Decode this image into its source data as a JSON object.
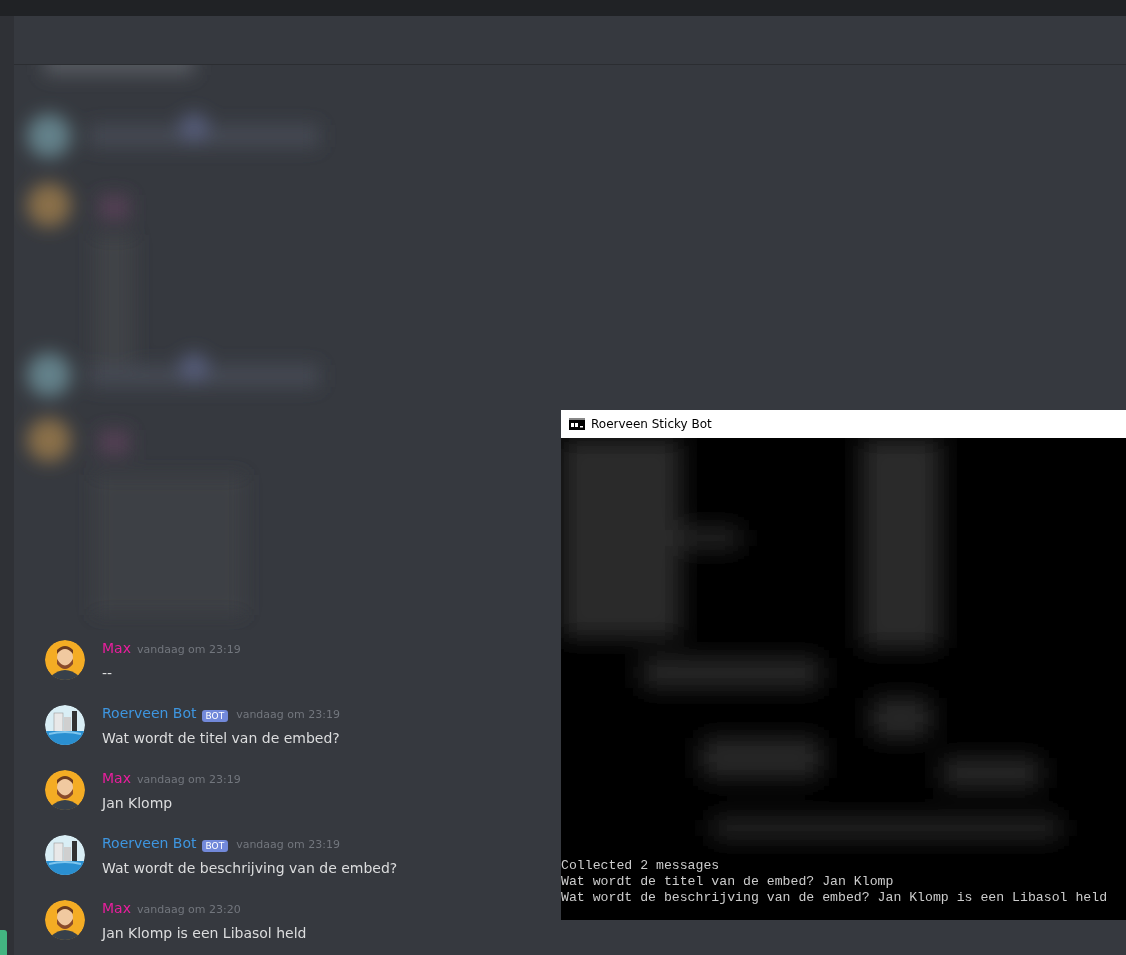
{
  "messages": [
    {
      "kind": "user",
      "author": "Max",
      "color": "#e91e9d",
      "time": "vandaag om 23:19",
      "text": "--"
    },
    {
      "kind": "bot",
      "author": "Roerveen Bot",
      "color": "#3e96e0",
      "badge": "BOT",
      "time": "vandaag om 23:19",
      "text": "Wat wordt de titel van de embed?"
    },
    {
      "kind": "user",
      "author": "Max",
      "color": "#e91e9d",
      "time": "vandaag om 23:19",
      "text": "Jan Klomp"
    },
    {
      "kind": "bot",
      "author": "Roerveen Bot",
      "color": "#3e96e0",
      "badge": "BOT",
      "time": "vandaag om 23:19",
      "text": "Wat wordt de beschrijving van de embed?"
    },
    {
      "kind": "user",
      "author": "Max",
      "color": "#e91e9d",
      "time": "vandaag om 23:20",
      "text": "Jan Klomp is een Libasol held"
    }
  ],
  "console": {
    "title": "Roerveen Sticky Bot",
    "lines": [
      "Collected 2 messages",
      "Wat wordt de titel van de embed? Jan Klomp",
      "Wat wordt de beschrijving van de embed? Jan Klomp is een Libasol held"
    ]
  }
}
